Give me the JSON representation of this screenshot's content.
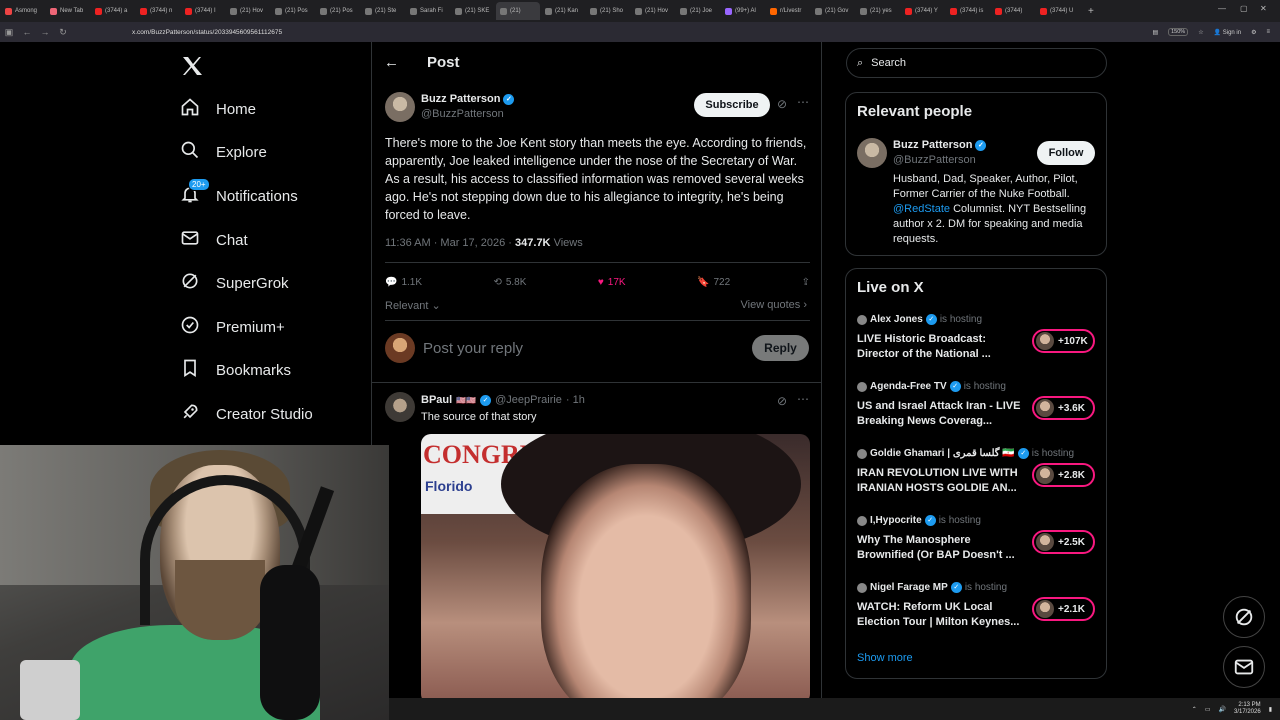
{
  "browser": {
    "tabs": [
      {
        "label": "Asmong",
        "color": "#e44"
      },
      {
        "label": "New Tab",
        "color": "#e67"
      },
      {
        "label": "(3744) a",
        "color": "#e22"
      },
      {
        "label": "(3744) n",
        "color": "#e22"
      },
      {
        "label": "(3744) I",
        "color": "#e22"
      },
      {
        "label": "(21) Hov",
        "color": "#777"
      },
      {
        "label": "(21) Pos",
        "color": "#777"
      },
      {
        "label": "(21) Pos",
        "color": "#777"
      },
      {
        "label": "(21) Ste",
        "color": "#777"
      },
      {
        "label": "Sarah Fi",
        "color": "#777"
      },
      {
        "label": "(21) SKE",
        "color": "#777"
      },
      {
        "label": "(21)",
        "color": "#777"
      },
      {
        "label": "(21) Kan",
        "color": "#777"
      },
      {
        "label": "(21) Sho",
        "color": "#777"
      },
      {
        "label": "(21) Hov",
        "color": "#777"
      },
      {
        "label": "(21) Joe",
        "color": "#777"
      },
      {
        "label": "(99+) Al",
        "color": "#96f"
      },
      {
        "label": "r/Livestr",
        "color": "#f60"
      },
      {
        "label": "(21) Gov",
        "color": "#777"
      },
      {
        "label": "(21) yes",
        "color": "#777"
      },
      {
        "label": "(3744) Y",
        "color": "#e22"
      },
      {
        "label": "(3744) is",
        "color": "#e22"
      },
      {
        "label": "(3744)",
        "color": "#e22"
      },
      {
        "label": "(3744) U",
        "color": "#e22"
      }
    ],
    "active_tab_index": 11,
    "url": "x.com/BuzzPatterson/status/2033945609561112675",
    "zoom": "150%",
    "sign_in": "Sign in"
  },
  "nav": {
    "items": [
      {
        "label": "Home",
        "icon": "home-icon"
      },
      {
        "label": "Explore",
        "icon": "search-icon"
      },
      {
        "label": "Notifications",
        "icon": "bell-icon",
        "badge": "20+"
      },
      {
        "label": "Chat",
        "icon": "mail-icon"
      },
      {
        "label": "SuperGrok",
        "icon": "grok-icon"
      },
      {
        "label": "Premium+",
        "icon": "premium-icon"
      },
      {
        "label": "Bookmarks",
        "icon": "bookmark-icon"
      },
      {
        "label": "Creator Studio",
        "icon": "rocket-icon"
      }
    ]
  },
  "post": {
    "header_title": "Post",
    "author_name": "Buzz Patterson",
    "author_handle": "@BuzzPatterson",
    "subscribe_label": "Subscribe",
    "text": "There's more to the Joe Kent story than meets the eye. According to friends, apparently, Joe leaked intelligence under the nose of the Secretary of War. As a result, his access to classified information was removed several weeks ago. He's not stepping down due to his allegiance to integrity, he's being forced to leave.",
    "time": "11:36 AM · Mar 17, 2026 · ",
    "views_count": "347.7K",
    "views_label": " Views",
    "replies": "1.1K",
    "reposts": "5.8K",
    "likes": "17K",
    "bookmarks": "722",
    "relevant_label": "Relevant",
    "view_quotes_label": "View quotes",
    "reply_placeholder": "Post your reply",
    "reply_button": "Reply"
  },
  "comment": {
    "name": "BPaul",
    "flags": "🇺🇸🇺🇸",
    "handle": "@JeepPrairie",
    "time": "· 1h",
    "text": "The source of that story",
    "image_banner": "CONGRES",
    "image_sub": "Florido"
  },
  "right": {
    "search_placeholder": "Search",
    "relevant_people_title": "Relevant people",
    "rp_name": "Buzz Patterson",
    "rp_handle": "@BuzzPatterson",
    "follow_label": "Follow",
    "rp_bio_1": "Husband, Dad, Speaker, Author, Pilot, Former Carrier of the Nuke Football. ",
    "rp_bio_mention": "@RedState",
    "rp_bio_2": " Columnist. NYT Bestselling author x 2. DM for speaking and media requests.",
    "live_title": "Live on X",
    "live": [
      {
        "host": "Alex Jones",
        "hosting": "is hosting",
        "title": "LIVE Historic Broadcast: Director of the National ...",
        "count": "+107K"
      },
      {
        "host": "Agenda-Free TV",
        "hosting": "is hosting",
        "title": "US and Israel Attack Iran - LIVE Breaking News Coverag...",
        "count": "+3.6K"
      },
      {
        "host": "Goldie Ghamari | گلسا قمری 🇮🇷",
        "hosting": "is hosting",
        "title": "IRAN REVOLUTION LIVE WITH IRANIAN HOSTS GOLDIE AN...",
        "count": "+2.8K"
      },
      {
        "host": "I,Hypocrite",
        "hosting": "is hosting",
        "title": "Why The Manosphere Brownified (Or BAP Doesn't ...",
        "count": "+2.5K"
      },
      {
        "host": "Nigel Farage MP",
        "hosting": "is hosting",
        "title": "WATCH: Reform UK Local Election Tour | Milton Keynes...",
        "count": "+2.1K"
      }
    ],
    "show_more": "Show more"
  },
  "taskbar": {
    "time": "2:13 PM",
    "date": "3/17/2026"
  },
  "colors": {
    "accent": "#1d9bf0",
    "like": "#f91880",
    "live_ring": "#f91880"
  }
}
